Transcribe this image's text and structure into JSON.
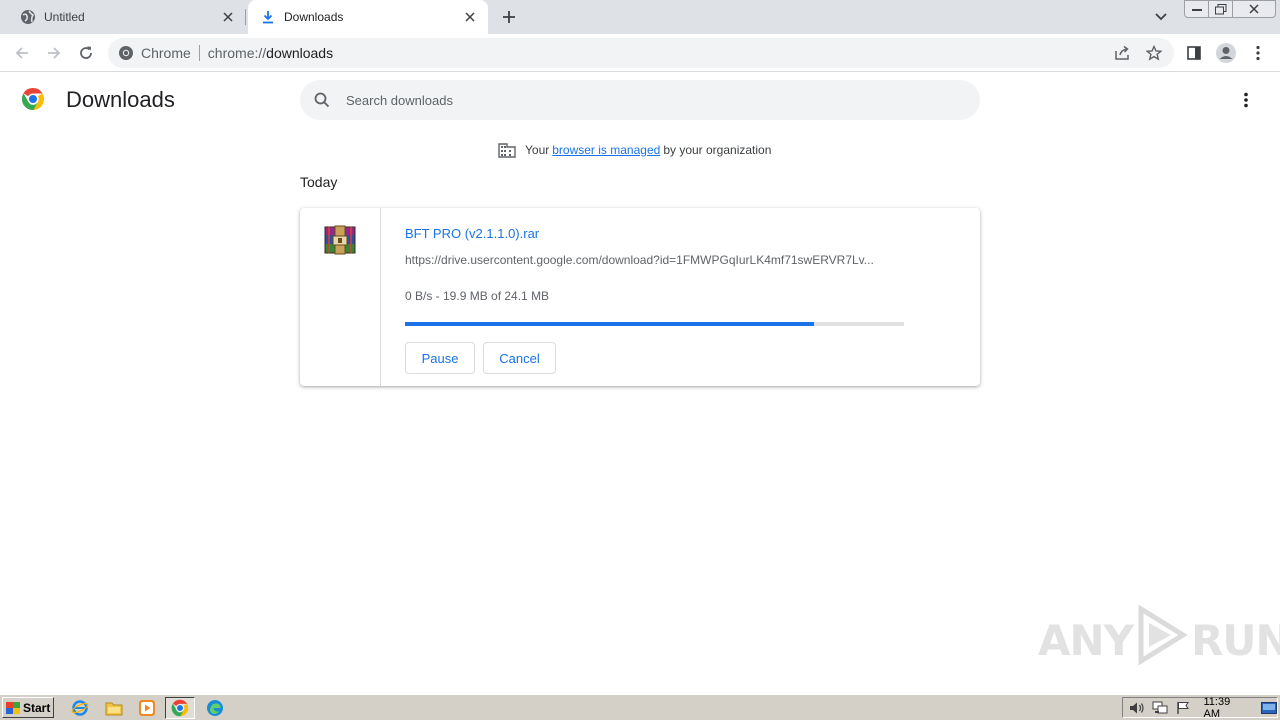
{
  "tabs": [
    {
      "title": "Untitled",
      "favicon": "globe-icon",
      "active": false
    },
    {
      "title": "Downloads",
      "favicon": "download-icon",
      "active": true
    }
  ],
  "omnibox": {
    "site_chip": "Chrome",
    "url_scheme": "chrome://",
    "url_host": "downloads"
  },
  "page": {
    "title": "Downloads",
    "search_placeholder": "Search downloads",
    "managed_prefix": "Your",
    "managed_link": "browser is managed",
    "managed_suffix": "by your organization",
    "section_today": "Today"
  },
  "download": {
    "file_name": "BFT PRO (v2.1.1.0).rar",
    "url": "https://drive.usercontent.google.com/download?id=1FMWPGqIurLK4mf71swERVR7Lv...",
    "status": "0 B/s - 19.9 MB of 24.1 MB",
    "progress": 0.82,
    "pause_label": "Pause",
    "cancel_label": "Cancel",
    "file_icon": "winrar-archive-icon"
  },
  "watermark": {
    "left": "ANY",
    "right": "RUN"
  },
  "taskbar": {
    "start_label": "Start",
    "clock": "11:39 AM"
  },
  "colors": {
    "accent": "#1a73e8",
    "tabstrip": "#dee1e6",
    "taskbar": "#d4d0c8"
  }
}
